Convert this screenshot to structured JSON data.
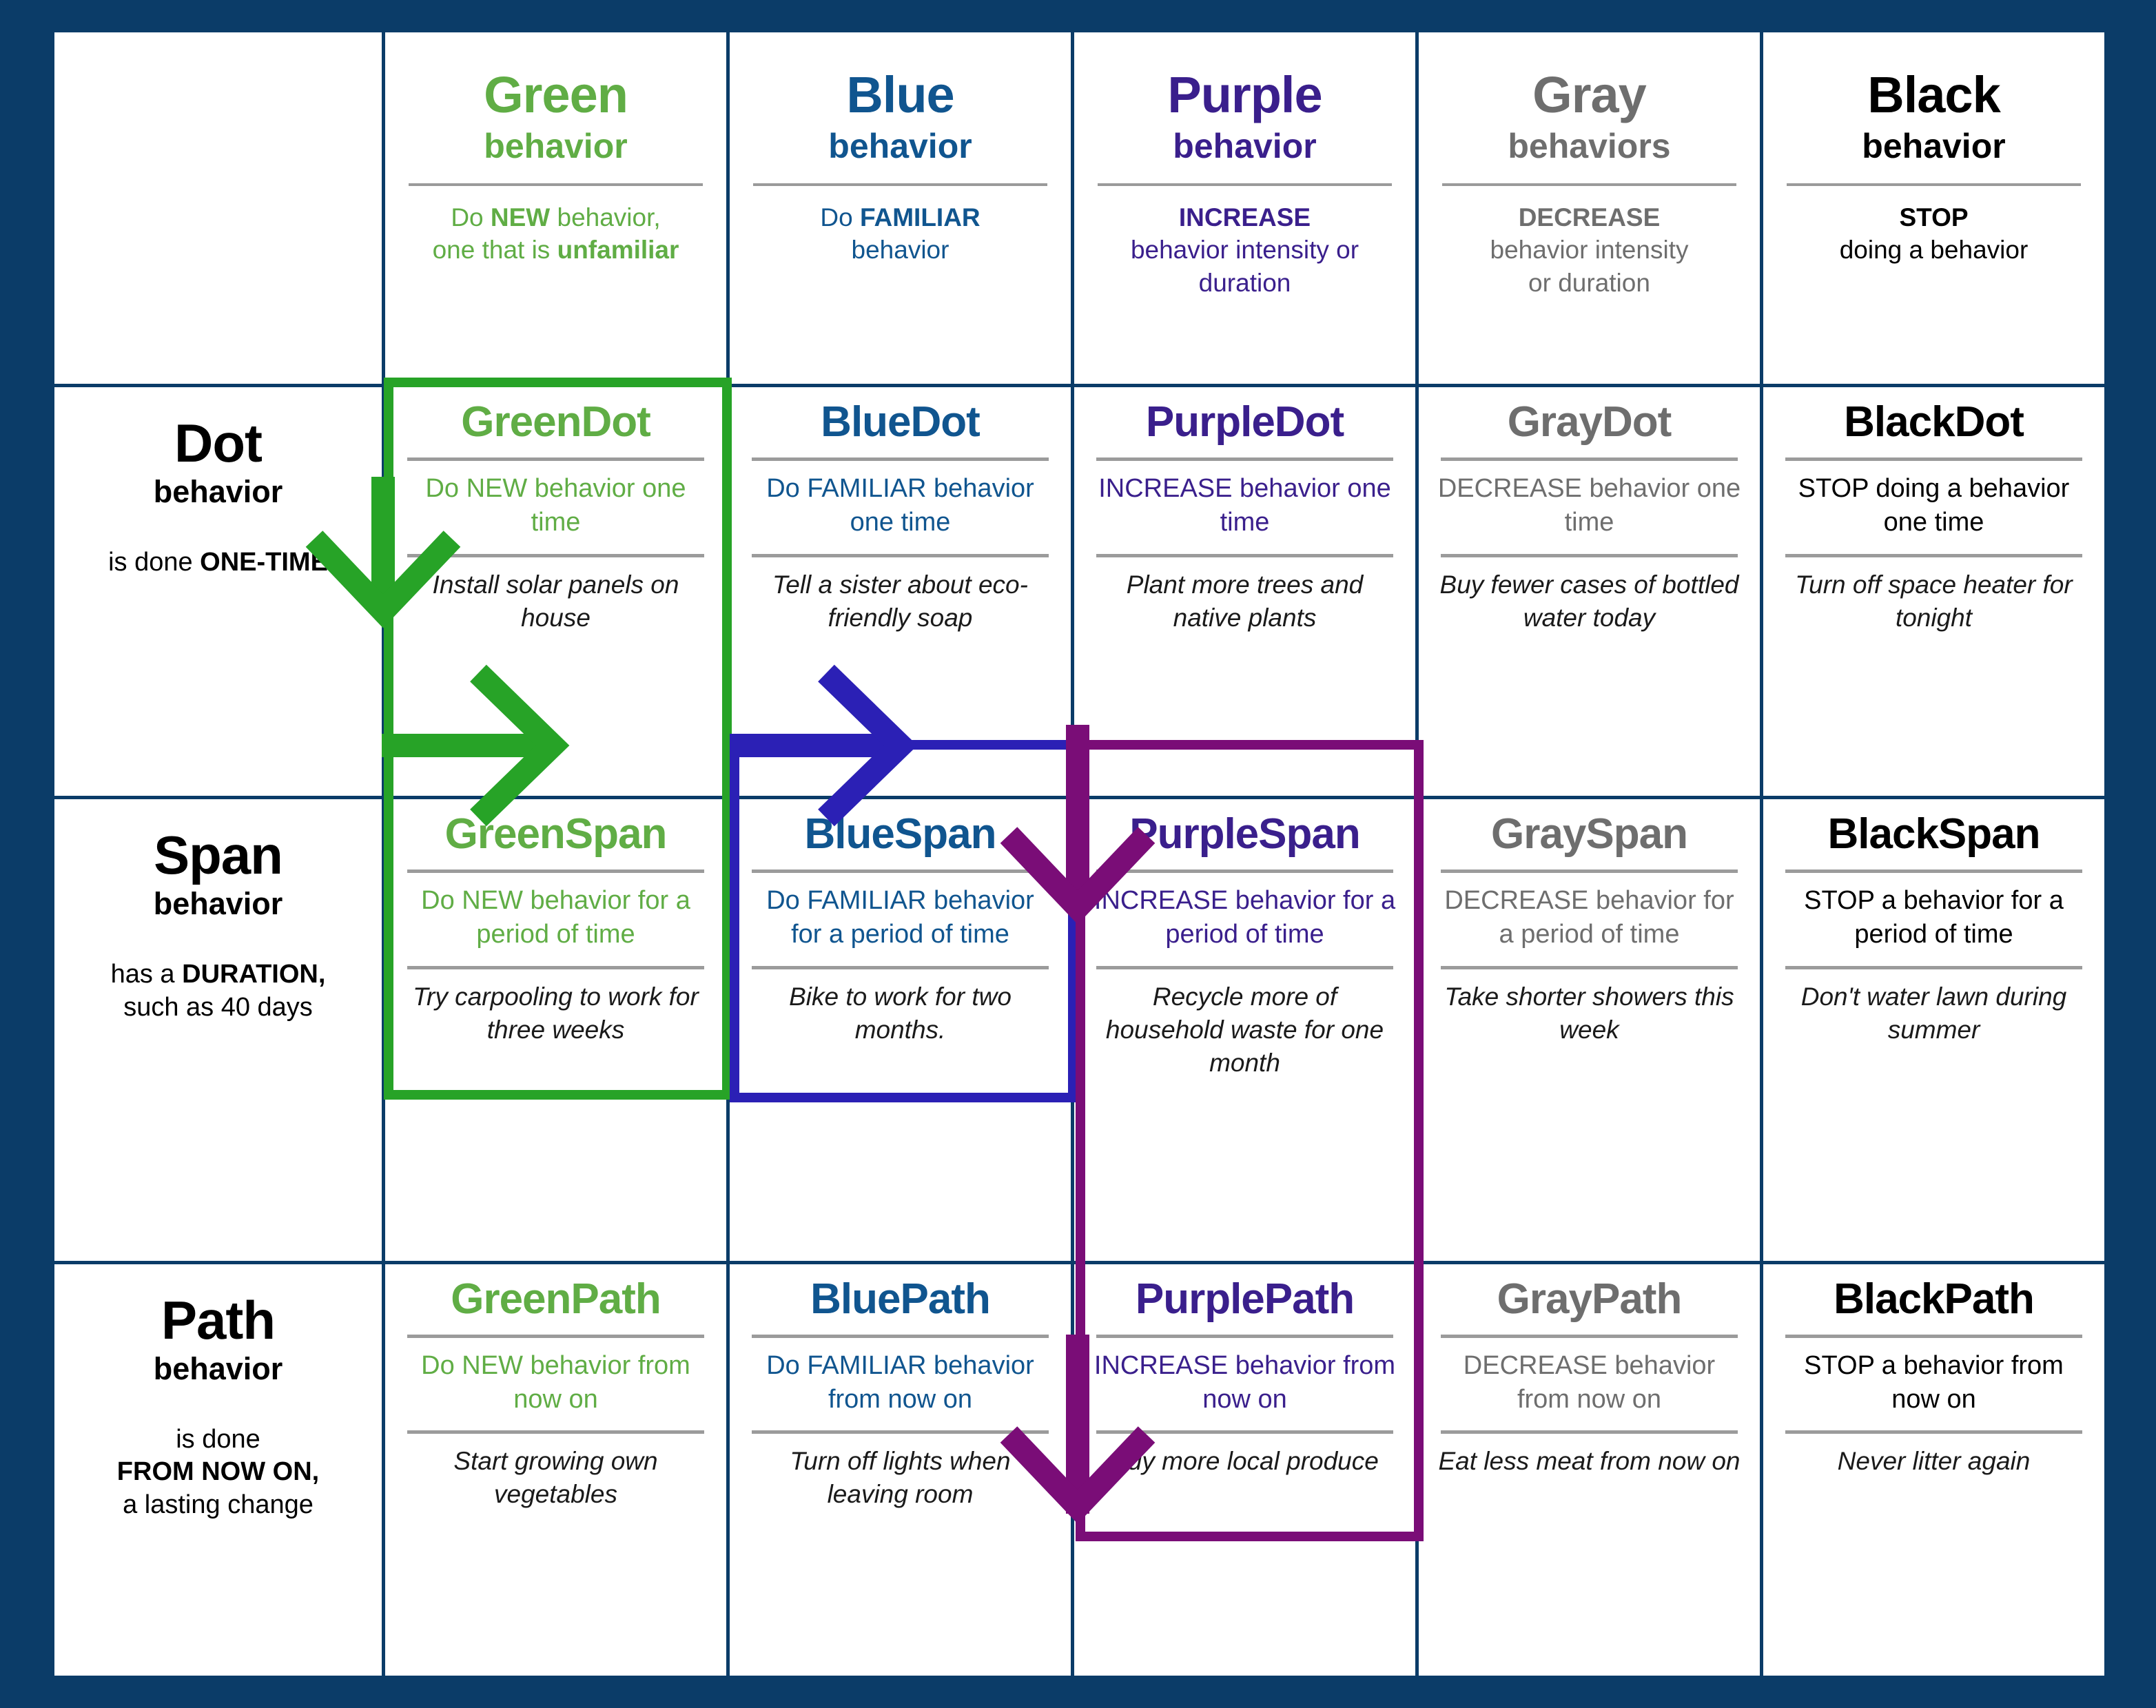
{
  "colors": {
    "frame": "#0b3c68",
    "header_bg": "#cccccc",
    "green": "#60ad45",
    "blue": "#10558f",
    "purple": "#3a1f8c",
    "gray": "#6e6e6e",
    "black": "#000000",
    "arrow_green": "#27a327",
    "arrow_blue": "#2b20b5",
    "arrow_purple": "#7a0d77"
  },
  "columns": [
    {
      "key": "green",
      "title": "Green",
      "subtitle": "behavior",
      "desc_line1_pre": "Do ",
      "desc_line1_bold": "NEW",
      "desc_line1_post": " behavior,",
      "desc_line2_pre": "one that is ",
      "desc_line2_bold": "unfamiliar",
      "desc_line2_post": ""
    },
    {
      "key": "blue",
      "title": "Blue",
      "subtitle": "behavior",
      "desc_line1_pre": "Do ",
      "desc_line1_bold": "FAMILIAR",
      "desc_line1_post": "",
      "desc_line2_pre": "behavior",
      "desc_line2_bold": "",
      "desc_line2_post": ""
    },
    {
      "key": "purple",
      "title": "Purple",
      "subtitle": "behavior",
      "desc_line1_pre": "",
      "desc_line1_bold": "INCREASE",
      "desc_line1_post": "",
      "desc_line2_pre": "behavior intensity or",
      "desc_line2_bold": "",
      "desc_line2_post": "",
      "desc_line3": "duration"
    },
    {
      "key": "gray",
      "title": "Gray",
      "subtitle": "behaviors",
      "desc_line1_pre": "",
      "desc_line1_bold": "DECREASE",
      "desc_line1_post": "",
      "desc_line2_pre": "behavior intensity",
      "desc_line2_bold": "",
      "desc_line2_post": "",
      "desc_line3": "or duration"
    },
    {
      "key": "black",
      "title": "Black",
      "subtitle": "behavior",
      "desc_line1_pre": "",
      "desc_line1_bold": "STOP",
      "desc_line1_post": "",
      "desc_line2_pre": "doing a behavior",
      "desc_line2_bold": "",
      "desc_line2_post": ""
    }
  ],
  "rows": [
    {
      "key": "dot",
      "title": "Dot",
      "subtitle": "behavior",
      "desc_pre": "is done ",
      "desc_bold": "ONE-TIME",
      "desc_post": ""
    },
    {
      "key": "span",
      "title": "Span",
      "subtitle": "behavior",
      "desc_pre": "has a ",
      "desc_bold": "DURATION,",
      "desc_post": "",
      "desc_line2": "such as 40 days"
    },
    {
      "key": "path",
      "title": "Path",
      "subtitle": "behavior",
      "desc_pre": "is done",
      "desc_bold": "FROM NOW ON,",
      "desc_post": "",
      "desc_line2": "a lasting change"
    }
  ],
  "cells": {
    "dot": [
      {
        "title": "GreenDot",
        "def": "Do NEW behavior one time",
        "example": "Install solar panels on house"
      },
      {
        "title": "BlueDot",
        "def": "Do FAMILIAR behavior one time",
        "example": "Tell a sister about eco-friendly soap"
      },
      {
        "title": "PurpleDot",
        "def": "INCREASE behavior one time",
        "example": "Plant more trees and native plants"
      },
      {
        "title": "GrayDot",
        "def": "DECREASE behavior one time",
        "example": "Buy fewer cases of bottled water today"
      },
      {
        "title": "BlackDot",
        "def": "STOP doing a behavior one time",
        "example": "Turn off space heater for tonight"
      }
    ],
    "span": [
      {
        "title": "GreenSpan",
        "def": "Do NEW behavior for a period of time",
        "example": "Try carpooling to work for three weeks"
      },
      {
        "title": "BlueSpan",
        "def": "Do FAMILIAR behavior for a period of time",
        "example": "Bike to work for two months."
      },
      {
        "title": "PurpleSpan",
        "def": "INCREASE behavior for a period of time",
        "example": "Recycle more of household waste for one month"
      },
      {
        "title": "GraySpan",
        "def": "DECREASE behavior for a period of time",
        "example": "Take shorter showers this week"
      },
      {
        "title": "BlackSpan",
        "def": "STOP a behavior for a period of time",
        "example": "Don't water lawn during summer"
      }
    ],
    "path": [
      {
        "title": "GreenPath",
        "def": "Do NEW behavior from now on",
        "example": "Start growing own vegetables"
      },
      {
        "title": "BluePath",
        "def": "Do FAMILIAR behavior from now on",
        "example": "Turn off lights when leaving room"
      },
      {
        "title": "PurplePath",
        "def": "INCREASE behavior from now on",
        "example": "Buy more local produce"
      },
      {
        "title": "GrayPath",
        "def": "DECREASE behavior from now on",
        "example": "Eat less meat from now on"
      },
      {
        "title": "BlackPath",
        "def": "STOP a behavior from now on",
        "example": "Never litter again"
      }
    ]
  },
  "highlights": [
    {
      "name": "green-highlight-box",
      "color": "#27a327",
      "cells": "GreenDot + GreenSpan"
    },
    {
      "name": "blue-highlight-box",
      "color": "#2b20b5",
      "cells": "BlueSpan"
    },
    {
      "name": "purple-highlight-box",
      "color": "#7a0d77",
      "cells": "PurpleSpan + PurplePath"
    }
  ],
  "arrows": [
    {
      "name": "green-down-arrow",
      "color": "#27a327",
      "direction": "down"
    },
    {
      "name": "green-right-arrow",
      "color": "#27a327",
      "direction": "right"
    },
    {
      "name": "blue-right-arrow",
      "color": "#2b20b5",
      "direction": "right"
    },
    {
      "name": "purple-down-arrow-span",
      "color": "#7a0d77",
      "direction": "down"
    },
    {
      "name": "purple-down-arrow-path",
      "color": "#7a0d77",
      "direction": "down"
    }
  ]
}
